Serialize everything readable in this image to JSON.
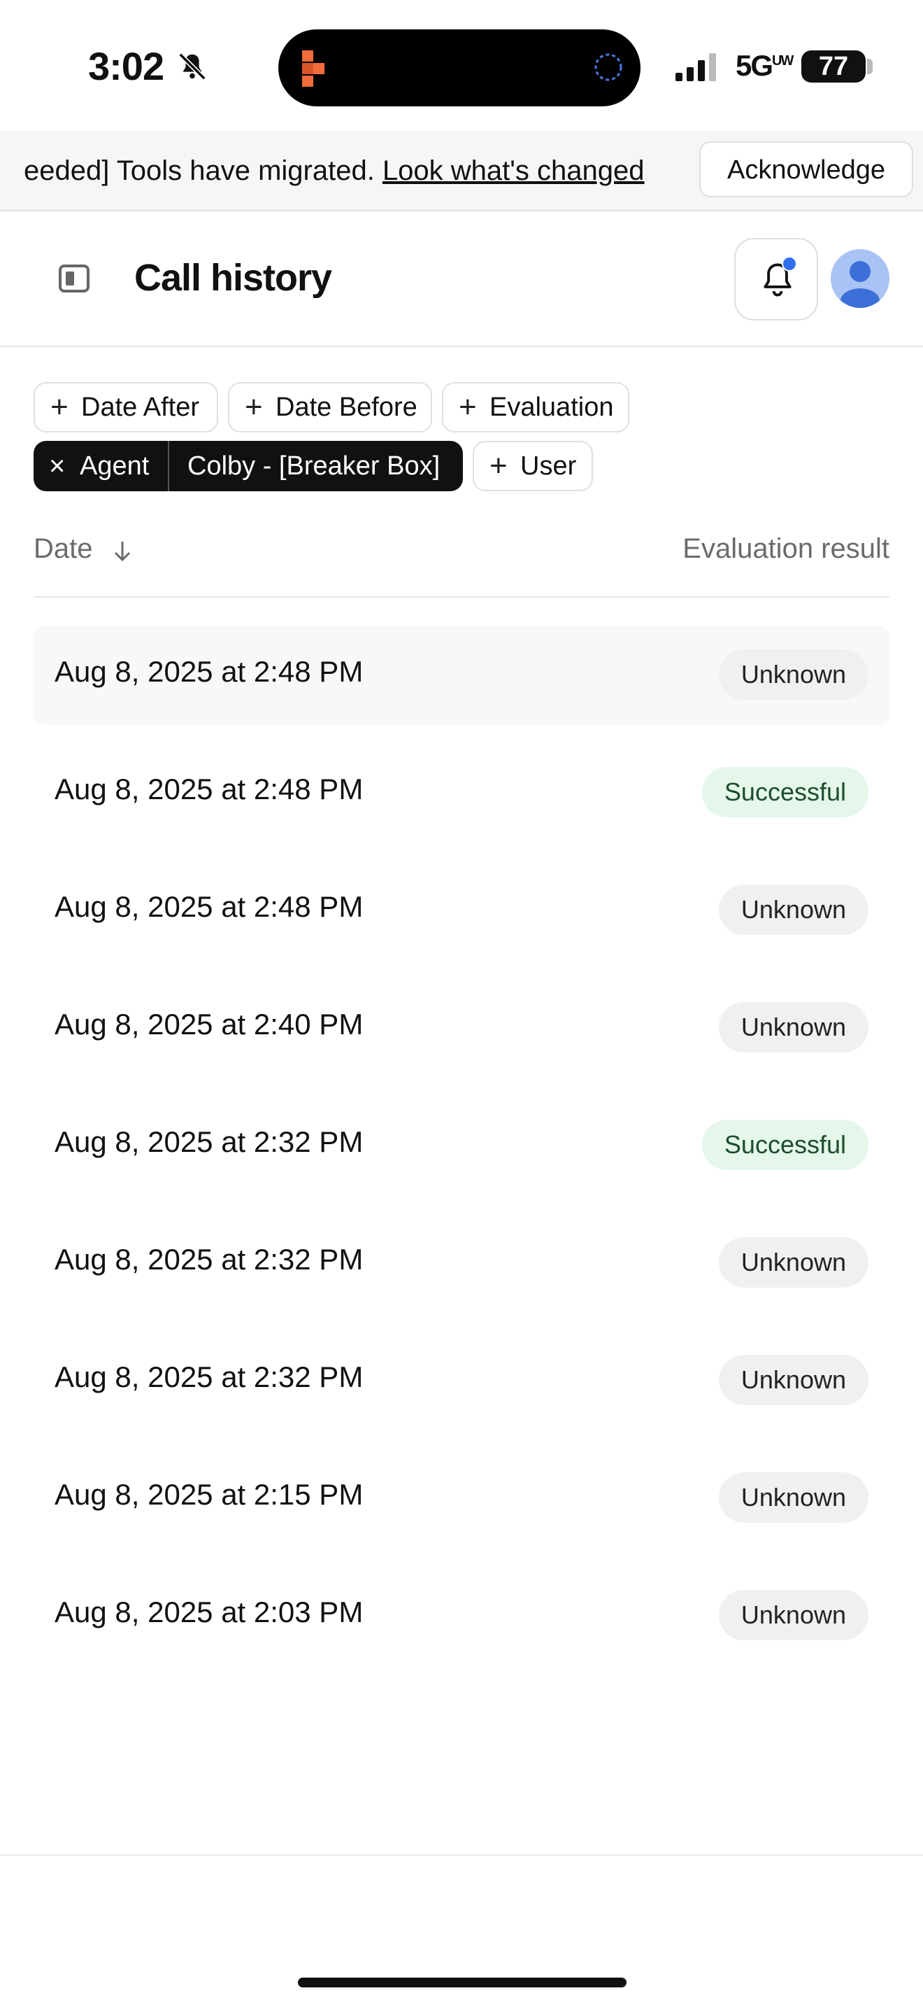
{
  "status_bar": {
    "time": "3:02",
    "network": "5G",
    "network_sup": "UW",
    "battery": "77"
  },
  "banner": {
    "text": "eeded] Tools have migrated. ",
    "link": "Look what's changed",
    "acknowledge_label": "Acknowledge"
  },
  "header": {
    "title": "Call history"
  },
  "filters": {
    "date_after": "Date After",
    "date_before": "Date Before",
    "evaluation": "Evaluation",
    "agent_label": "Agent",
    "agent_value": "Colby - [Breaker Box]",
    "user": "User",
    "plus": "+",
    "remove": "×"
  },
  "table": {
    "col_date": "Date",
    "col_eval": "Evaluation result",
    "rows": [
      {
        "date": "Aug 8, 2025 at 2:48 PM",
        "result": "Unknown"
      },
      {
        "date": "Aug 8, 2025 at 2:48 PM",
        "result": "Successful"
      },
      {
        "date": "Aug 8, 2025 at 2:48 PM",
        "result": "Unknown"
      },
      {
        "date": "Aug 8, 2025 at 2:40 PM",
        "result": "Unknown"
      },
      {
        "date": "Aug 8, 2025 at 2:32 PM",
        "result": "Successful"
      },
      {
        "date": "Aug 8, 2025 at 2:32 PM",
        "result": "Unknown"
      },
      {
        "date": "Aug 8, 2025 at 2:32 PM",
        "result": "Unknown"
      },
      {
        "date": "Aug 8, 2025 at 2:15 PM",
        "result": "Unknown"
      },
      {
        "date": "Aug 8, 2025 at 2:03 PM",
        "result": "Unknown"
      }
    ]
  },
  "colors": {
    "accent": "#2f6fed",
    "success_bg": "#e4f7ea",
    "unknown_bg": "#f0f0f0",
    "brand_orange": "#f26b3a"
  }
}
